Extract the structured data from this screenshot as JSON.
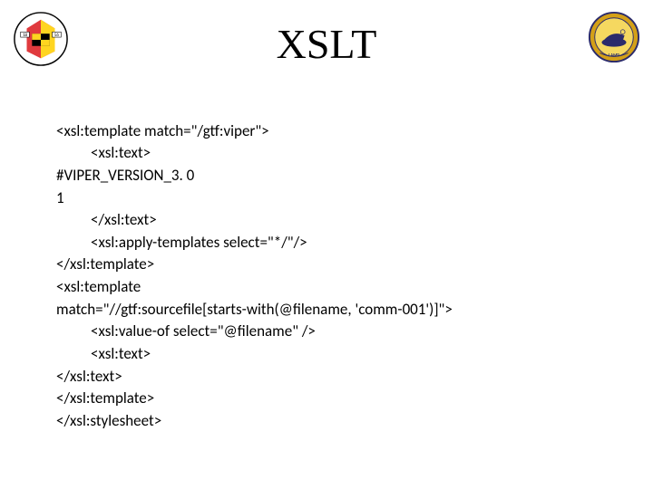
{
  "title": "XSLT",
  "logos": {
    "left_alt": "University of Maryland seal",
    "right_alt": "LAMP logo"
  },
  "code": {
    "l1": "<xsl:template match=\"/gtf:viper\">",
    "l2": "<xsl:text>",
    "l3": "#VIPER_VERSION_3. 0",
    "l4": "1",
    "l5": "</xsl:text>",
    "l6": "<xsl:apply-templates select=\"*/\"/>",
    "l7": "</xsl:template>",
    "l8": "<xsl:template",
    "l9": "match=\"//gtf:sourcefile[starts-with(@filename, 'comm-001')]\">",
    "l10": "<xsl:value-of select=\"@filename\" />",
    "l11": "<xsl:text>",
    "l12": "</xsl:text>",
    "l13": "</xsl:template>",
    "l14": "</xsl:stylesheet>"
  }
}
